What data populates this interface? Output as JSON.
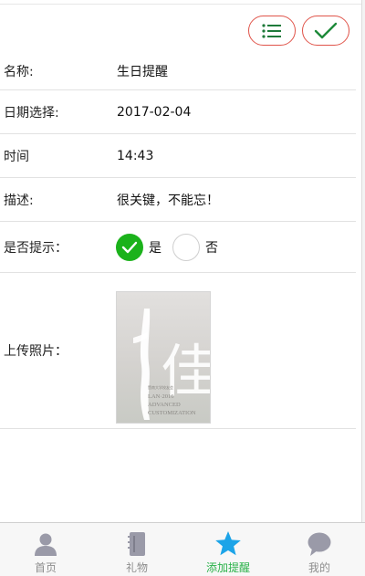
{
  "form": {
    "name_label": "名称:",
    "name_value": "生日提醒",
    "date_label": "日期选择:",
    "date_value": "2017-02-04",
    "time_label": "时间",
    "time_value": "14:43",
    "desc_label": "描述:",
    "desc_value": "很关键，不能忘！",
    "remind_label": "是否提示：",
    "remind_yes": "是",
    "remind_no": "否",
    "remind_selected": "是",
    "photo_label": "上传照片："
  },
  "photo": {
    "big_char": "佳",
    "caption_small": "暨南大学校友会",
    "caption_line1": "LAN·2016",
    "caption_line2": "ADVANCED",
    "caption_line3": "CUSTOMIZATION"
  },
  "toolbar": {
    "list_icon": "list-icon",
    "confirm_icon": "check-icon"
  },
  "tabs": [
    {
      "label": "首页",
      "icon": "user-icon",
      "active": false
    },
    {
      "label": "礼物",
      "icon": "notebook-icon",
      "active": false
    },
    {
      "label": "添加提醒",
      "icon": "star-icon",
      "active": true
    },
    {
      "label": "我的",
      "icon": "chat-bubble-icon",
      "active": false
    }
  ],
  "colors": {
    "accent_red": "#e0544a",
    "check_green": "#1bb21b",
    "active_tab": "#2bb24a",
    "active_icon": "#1ca4e8",
    "inactive_icon": "#9a9aa8"
  }
}
